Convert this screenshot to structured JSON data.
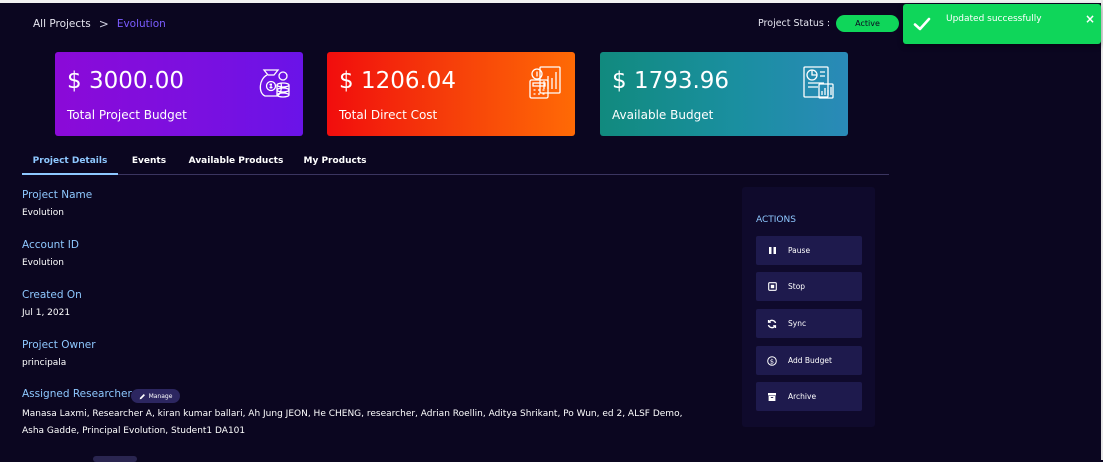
{
  "breadcrumb": {
    "root": "All Projects",
    "separator": ">",
    "current": "Evolution"
  },
  "status": {
    "label": "Project Status :",
    "value": "Active",
    "color": "#0fd65a"
  },
  "toast": {
    "message": "Updated successfully",
    "close": "×",
    "color": "#0fd65a"
  },
  "cards": {
    "budget": {
      "amount": "$ 3000.00",
      "label": "Total Project Budget",
      "icon": "money-bag-icon"
    },
    "cost": {
      "amount": "$ 1206.04",
      "label": "Total Direct Cost",
      "icon": "calculator-chart-icon"
    },
    "available": {
      "amount": "$ 1793.96",
      "label": "Available Budget",
      "icon": "budget-report-icon"
    }
  },
  "tabs": [
    {
      "label": "Project Details",
      "active": true
    },
    {
      "label": "Events",
      "active": false
    },
    {
      "label": "Available Products",
      "active": false
    },
    {
      "label": "My Products",
      "active": false
    }
  ],
  "details": {
    "project_name_label": "Project Name",
    "project_name": "Evolution",
    "account_id_label": "Account ID",
    "account_id": "Evolution",
    "created_on_label": "Created On",
    "created_on": "Jul 1, 2021",
    "owner_label": "Project Owner",
    "owner": "principala",
    "researchers_label": "Assigned Researchers",
    "manage_label": "Manage",
    "researchers": "Manasa Laxmi, Researcher A, kiran kumar ballari, Ah Jung JEON, He CHENG, researcher, Adrian Roellin, Aditya Shrikant, Po Wun, ed 2, ALSF Demo, Asha Gadde, Principal Evolution, Student1 DA101"
  },
  "actions": {
    "title": "ACTIONS",
    "items": [
      {
        "label": "Pause",
        "icon": "pause-icon"
      },
      {
        "label": "Stop",
        "icon": "stop-icon"
      },
      {
        "label": "Sync",
        "icon": "sync-icon"
      },
      {
        "label": "Add Budget",
        "icon": "dollar-circle-icon"
      },
      {
        "label": "Archive",
        "icon": "archive-icon"
      }
    ]
  }
}
